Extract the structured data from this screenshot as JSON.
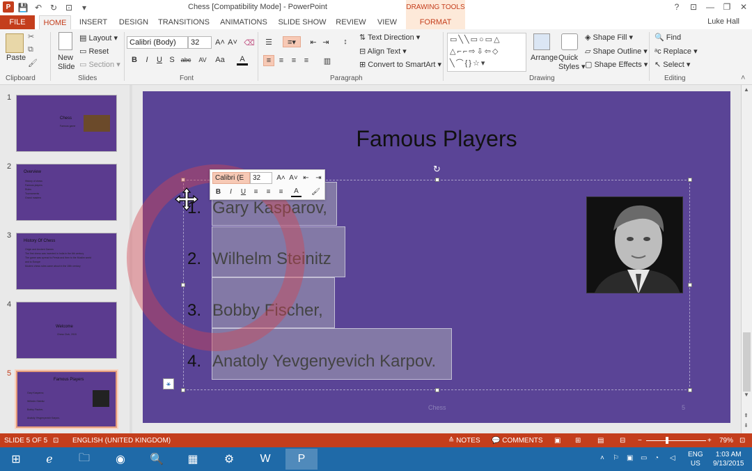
{
  "window": {
    "title": "Chess [Compatibility Mode] - PowerPoint",
    "context_tab_header": "DRAWING TOOLS",
    "user": "Luke Hall",
    "app_letter": "P"
  },
  "tabs": [
    "FILE",
    "HOME",
    "INSERT",
    "DESIGN",
    "TRANSITIONS",
    "ANIMATIONS",
    "SLIDE SHOW",
    "REVIEW",
    "VIEW",
    "FORMAT"
  ],
  "ribbon": {
    "clipboard": {
      "paste": "Paste",
      "label": "Clipboard"
    },
    "slides": {
      "new_slide": "New Slide",
      "new_slide_l1": "New",
      "new_slide_l2": "Slide",
      "layout": "Layout",
      "reset": "Reset",
      "section": "Section",
      "label": "Slides"
    },
    "font": {
      "family": "Calibri (Body)",
      "size": "32",
      "bold": "B",
      "italic": "I",
      "underline": "U",
      "shadow": "S",
      "strike": "abc",
      "spacing": "AV",
      "case": "Aa",
      "color": "A",
      "label": "Font"
    },
    "paragraph": {
      "text_direction": "Text Direction",
      "align_text": "Align Text",
      "convert_smartart": "Convert to SmartArt",
      "label": "Paragraph"
    },
    "drawing": {
      "arrange": "Arrange",
      "quick_styles_l1": "Quick",
      "quick_styles_l2": "Styles",
      "shape_fill": "Shape Fill",
      "shape_outline": "Shape Outline",
      "shape_effects": "Shape Effects",
      "label": "Drawing"
    },
    "editing": {
      "find": "Find",
      "replace": "Replace",
      "select": "Select",
      "label": "Editing"
    }
  },
  "thumbnails": [
    {
      "num": "1",
      "title": "Chess",
      "subtitle": "Famous game",
      "lines": []
    },
    {
      "num": "2",
      "title": "Overview",
      "subtitle": "",
      "lines": [
        "History of chess",
        "Famous players",
        "Rules",
        "Tournaments",
        "Grand masters"
      ]
    },
    {
      "num": "3",
      "title": "History Of Chess",
      "subtitle": "",
      "lines": [
        "Origin and Ancient Games",
        "The first chess was invented in India in the 6th century",
        "The game was spread to Persia and then to the Muslim world",
        "and to Europe",
        "Modern chess rules came about in the 15th century"
      ]
    },
    {
      "num": "4",
      "title": "Welcome",
      "subtitle": "Chess Club, 2015",
      "lines": []
    },
    {
      "num": "5",
      "title": "Famous Players",
      "subtitle": "",
      "lines": [
        "Gary Kasparov,",
        "Wilhelm Steinitz",
        "Bobby Fischer,",
        "Anatoly Yevgenyevich Karpov."
      ]
    }
  ],
  "slide": {
    "title": "Famous Players",
    "items": [
      {
        "num": "1.",
        "text": "Gary Kasparov,"
      },
      {
        "num": "2.",
        "text": "Wilhelm Steinitz"
      },
      {
        "num": "3.",
        "text": "Bobby Fischer,"
      },
      {
        "num": "4.",
        "text": "Anatoly Yevgenyevich Karpov."
      }
    ],
    "footer": "Chess",
    "page_number": "5",
    "background_color": "#5a4496"
  },
  "mini_toolbar": {
    "font": "Calibri (E",
    "size": "32"
  },
  "status": {
    "slide_info": "SLIDE 5 OF 5",
    "language": "ENGLISH (UNITED KINGDOM)",
    "notes": "NOTES",
    "comments": "COMMENTS",
    "zoom": "79%"
  },
  "tray": {
    "lang_1": "ENG",
    "lang_2": "US",
    "time": "1:03 AM",
    "date": "9/13/2015"
  },
  "colors": {
    "accent": "#c43e1c",
    "taskbar": "#1f6aa8",
    "slide": "#5a4496"
  }
}
